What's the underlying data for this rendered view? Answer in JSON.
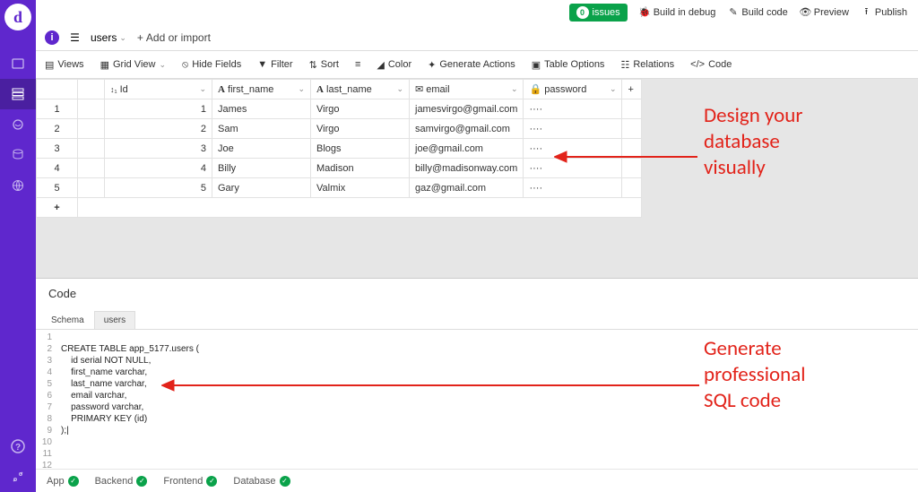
{
  "logo_letter": "d",
  "topnav": {
    "issues_count": "0",
    "issues": "issues",
    "build_debug": "Build in debug",
    "build_code": "Build code",
    "preview": "Preview",
    "publish": "Publish"
  },
  "subnav": {
    "table_name": "users",
    "add_import": "Add or import"
  },
  "toolbar": {
    "views": "Views",
    "grid_view": "Grid View",
    "hide_fields": "Hide Fields",
    "filter": "Filter",
    "sort": "Sort",
    "color": "Color",
    "generate_actions": "Generate Actions",
    "table_options": "Table Options",
    "relations": "Relations",
    "code": "Code"
  },
  "columns": {
    "id": "Id",
    "first_name": "first_name",
    "last_name": "last_name",
    "email": "email",
    "password": "password"
  },
  "rows": [
    {
      "n": "1",
      "id": "1",
      "fn": "James",
      "ln": "Virgo",
      "em": "jamesvirgo@gmail.com",
      "pw": "····"
    },
    {
      "n": "2",
      "id": "2",
      "fn": "Sam",
      "ln": "Virgo",
      "em": "samvirgo@gmail.com",
      "pw": "····"
    },
    {
      "n": "3",
      "id": "3",
      "fn": "Joe",
      "ln": "Blogs",
      "em": "joe@gmail.com",
      "pw": "····"
    },
    {
      "n": "4",
      "id": "4",
      "fn": "Billy",
      "ln": "Madison",
      "em": "billy@madisonway.com",
      "pw": "····"
    },
    {
      "n": "5",
      "id": "5",
      "fn": "Gary",
      "ln": "Valmix",
      "em": "gaz@gmail.com",
      "pw": "····"
    }
  ],
  "code_panel": {
    "title": "Code",
    "tabs": {
      "schema": "Schema",
      "users": "users"
    },
    "lines": [
      "",
      "CREATE TABLE app_5177.users (",
      "    id serial NOT NULL,",
      "    first_name varchar,",
      "    last_name varchar,",
      "    email varchar,",
      "    password varchar,",
      "    PRIMARY KEY (id)",
      ");|",
      "",
      "",
      "",
      ""
    ]
  },
  "footer": {
    "app": "App",
    "backend": "Backend",
    "frontend": "Frontend",
    "database": "Database"
  },
  "annotations": {
    "top": "Design your\ndatabase\nvisually",
    "bottom": "Generate\nprofessional\nSQL code"
  }
}
